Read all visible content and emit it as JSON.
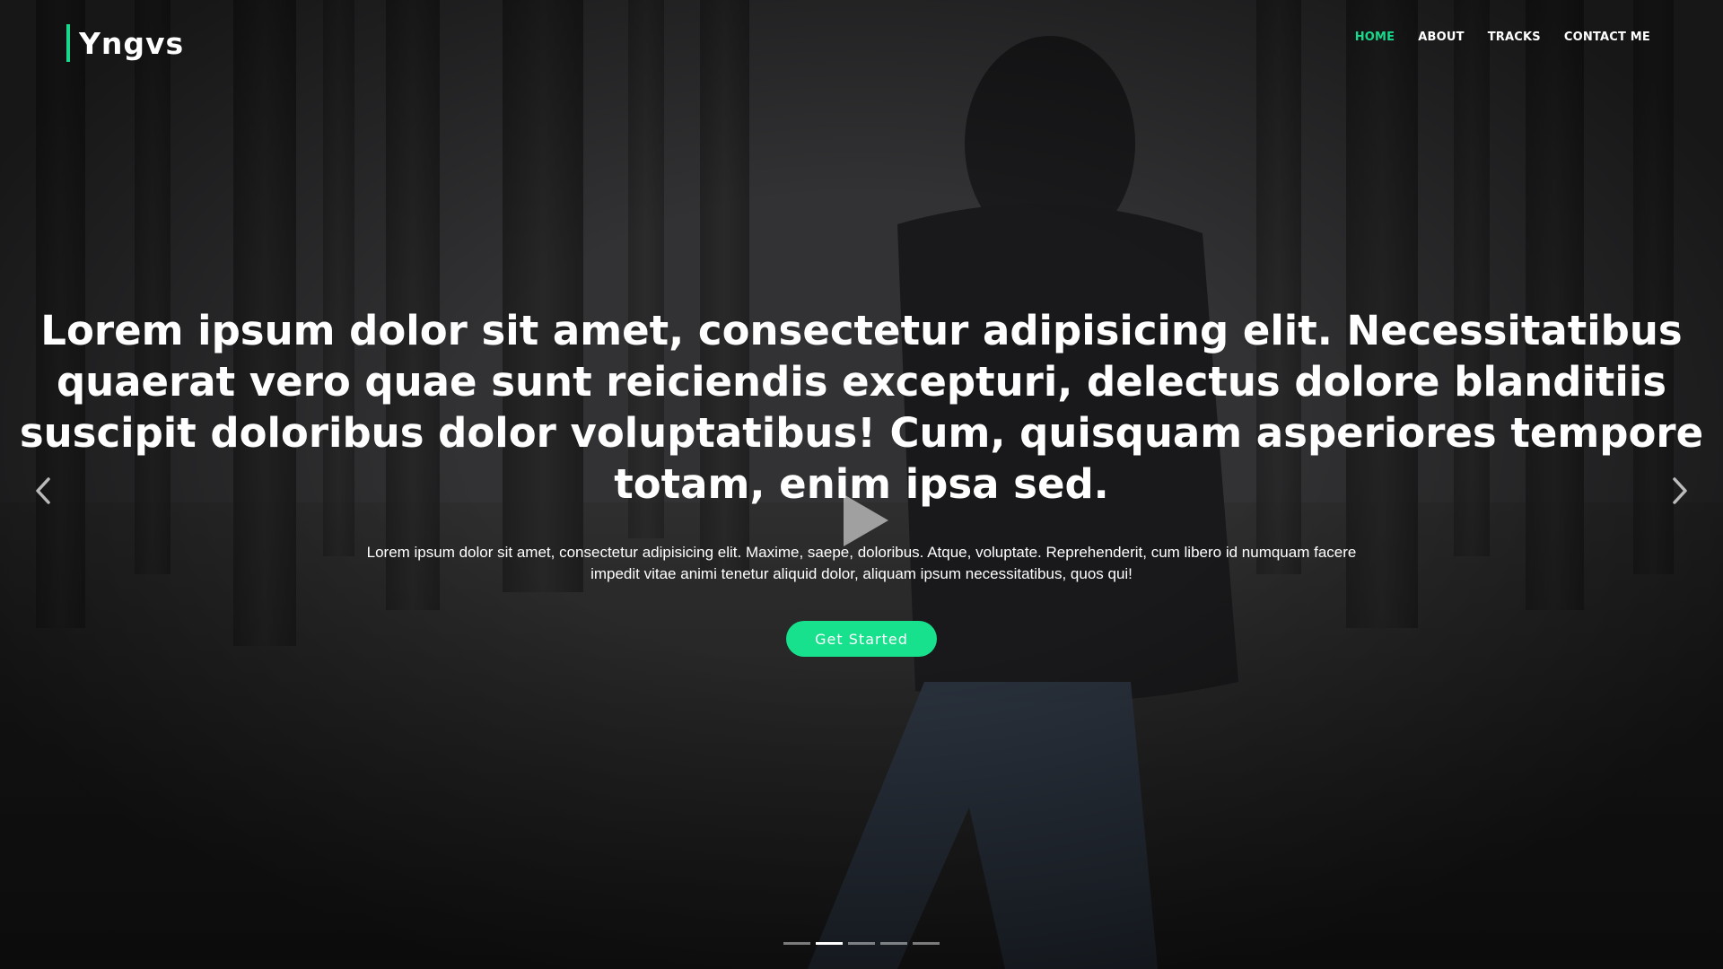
{
  "brand": {
    "name": "Yngvs",
    "accent_color": "#18d98b"
  },
  "nav": {
    "items": [
      {
        "label": "HOME",
        "active": true
      },
      {
        "label": "ABOUT",
        "active": false
      },
      {
        "label": "TRACKS",
        "active": false
      },
      {
        "label": "CONTACT ME",
        "active": false
      }
    ]
  },
  "hero": {
    "headline": "Lorem ipsum dolor sit amet, consectetur adipisicing elit. Necessitatibus quaerat vero quae sunt reiciendis excepturi, delectus dolore blanditiis suscipit doloribus dolor voluptatibus! Cum, quisquam asperiores tempore totam, enim ipsa sed.",
    "subtext": "Lorem ipsum dolor sit amet, consectetur adipisicing elit. Maxime, saepe, doloribus. Atque, voluptate. Reprehenderit, cum libero id numquam facere impedit vitae animi tenetur aliquid dolor, aliquam ipsum necessitatibus, quos qui!",
    "cta_label": "Get Started",
    "cta_color": "#18e18e"
  },
  "carousel": {
    "prev_icon": "chevron-left-icon",
    "next_icon": "chevron-right-icon",
    "play_icon": "play-icon",
    "slide_count": 5,
    "active_slide": 2
  }
}
